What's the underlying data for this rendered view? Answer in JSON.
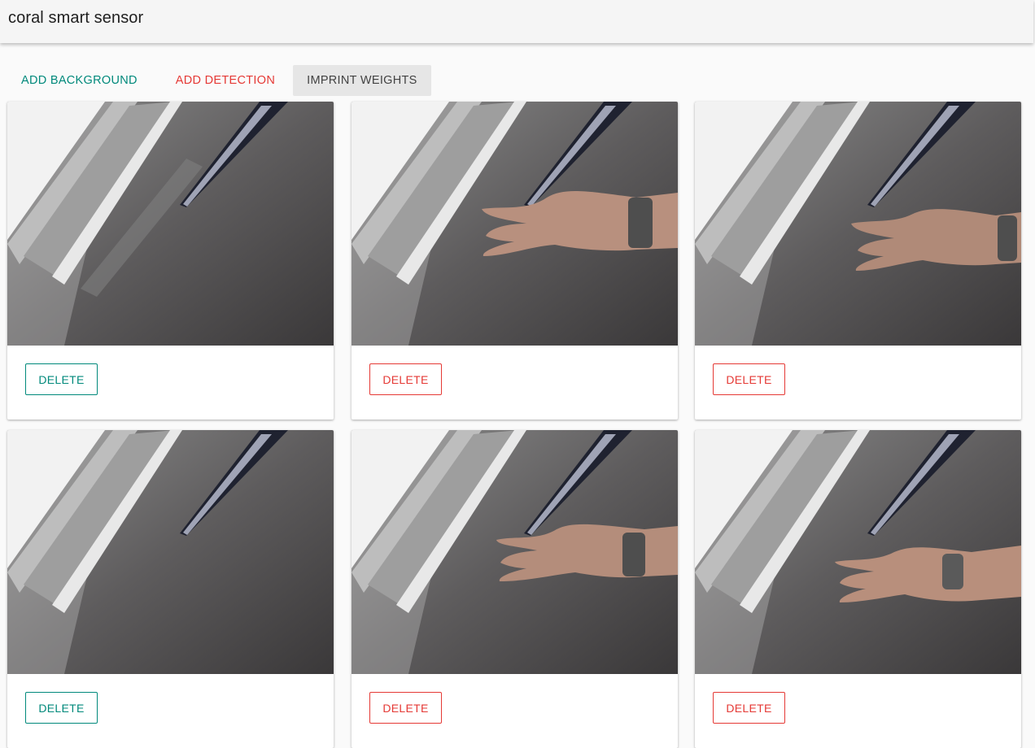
{
  "app": {
    "title": "coral smart sensor"
  },
  "toolbar": {
    "add_background": "ADD BACKGROUND",
    "add_detection": "ADD DETECTION",
    "imprint_weights": "IMPRINT WEIGHTS"
  },
  "colors": {
    "primary": "#00897b",
    "danger": "#e53935",
    "neutral_button_bg": "#e6e6e6"
  },
  "cards": [
    {
      "kind": "background",
      "delete_label": "DELETE",
      "hand_visible": false
    },
    {
      "kind": "detection",
      "delete_label": "DELETE",
      "hand_visible": true
    },
    {
      "kind": "detection",
      "delete_label": "DELETE",
      "hand_visible": true
    },
    {
      "kind": "background",
      "delete_label": "DELETE",
      "hand_visible": false
    },
    {
      "kind": "detection",
      "delete_label": "DELETE",
      "hand_visible": true
    },
    {
      "kind": "detection",
      "delete_label": "DELETE",
      "hand_visible": true
    }
  ]
}
